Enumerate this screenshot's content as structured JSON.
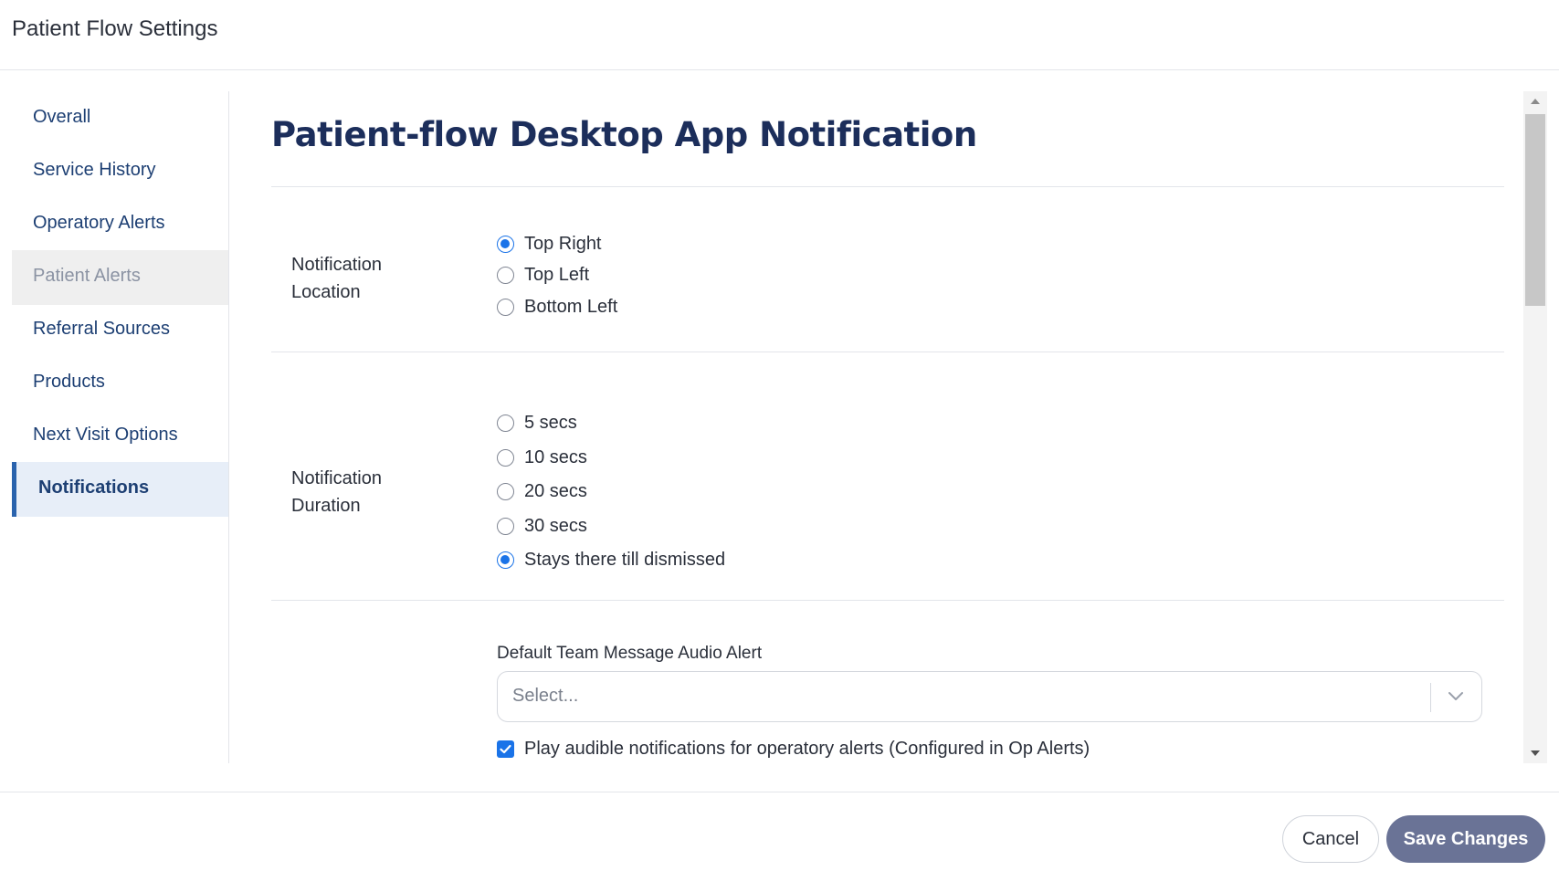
{
  "app": {
    "title": "Patient Flow Settings"
  },
  "sidebar": {
    "items": [
      {
        "label": "Overall",
        "state": "normal"
      },
      {
        "label": "Service History",
        "state": "normal"
      },
      {
        "label": "Operatory Alerts",
        "state": "normal"
      },
      {
        "label": "Patient Alerts",
        "state": "disabled"
      },
      {
        "label": "Referral Sources",
        "state": "normal"
      },
      {
        "label": "Products",
        "state": "normal"
      },
      {
        "label": "Next Visit Options",
        "state": "normal"
      },
      {
        "label": "Notifications",
        "state": "active"
      }
    ]
  },
  "main": {
    "heading": "Patient-flow Desktop App Notification",
    "location": {
      "label_line1": "Notification",
      "label_line2": "Location",
      "options": [
        "Top Right",
        "Top Left",
        "Bottom Left"
      ],
      "selected": "Top Right"
    },
    "duration": {
      "label_line1": "Notification",
      "label_line2": "Duration",
      "options": [
        "5 secs",
        "10 secs",
        "20 secs",
        "30 secs",
        "Stays there till dismissed"
      ],
      "selected": "Stays there till dismissed"
    },
    "audio": {
      "label": "Default Team Message Audio Alert",
      "placeholder": "Select..."
    },
    "op_alerts_checkbox": {
      "label": "Play audible notifications for operatory alerts (Configured in Op Alerts)",
      "checked": true
    }
  },
  "footer": {
    "cancel_label": "Cancel",
    "save_label": "Save Changes"
  },
  "colors": {
    "accent": "#1a73e8",
    "nav_text": "#1d3f73",
    "heading": "#1c2e5b",
    "save_button": "#6a7396",
    "active_nav_bg": "#e7eef8"
  }
}
